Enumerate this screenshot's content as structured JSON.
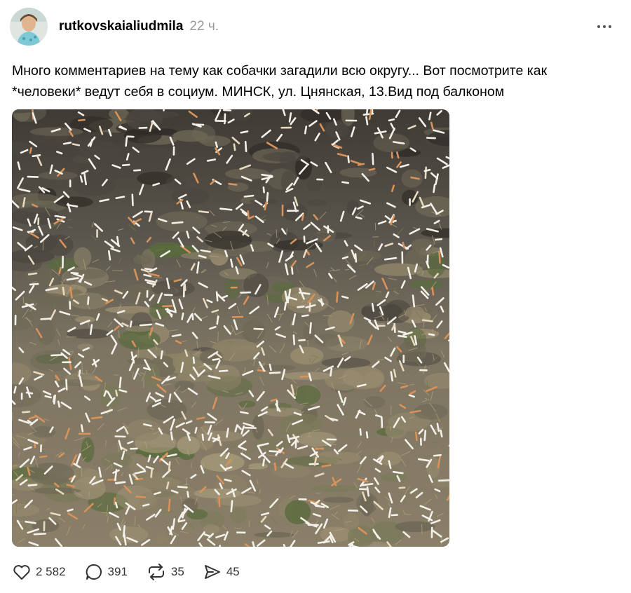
{
  "post": {
    "username": "rutkovskaialiudmila",
    "timestamp": "22 ч.",
    "text": "Много комментариев на тему как собачки загадили всю округу... Вот посмотрите как\n*человеки* ведут себя в социум. МИНСК, ул. Цнянская, 13.Вид под балконом",
    "image_icon": "photo-of-ground-with-cigarette-butts"
  },
  "actions": {
    "likes": "2 582",
    "comments": "391",
    "reposts": "35",
    "shares": "45"
  },
  "colors": {
    "text": "#000000",
    "muted": "#999999",
    "icon": "#333333"
  }
}
